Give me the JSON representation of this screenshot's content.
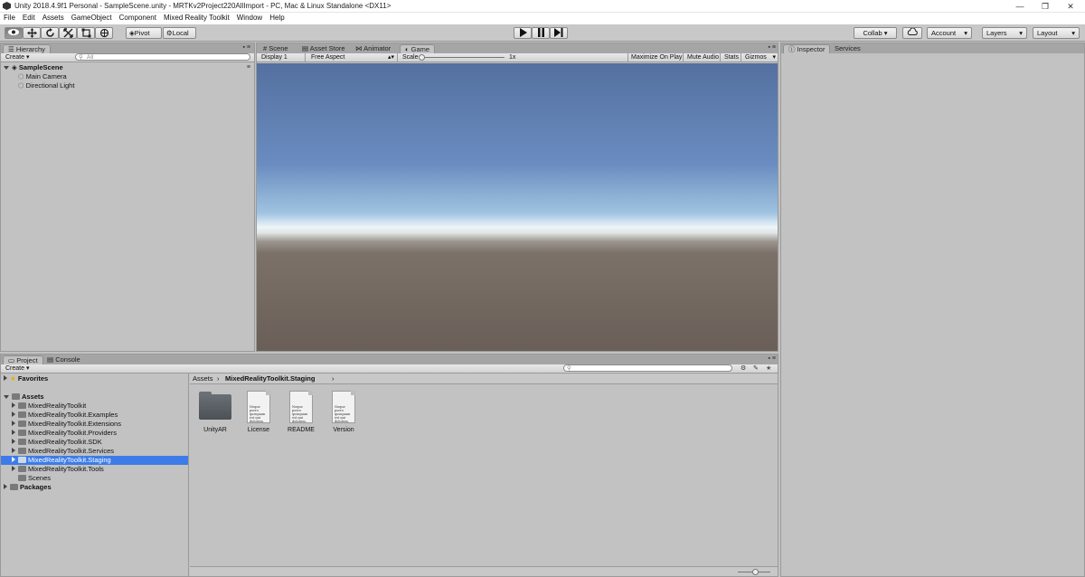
{
  "window": {
    "title": "Unity 2018.4.9f1 Personal - SampleScene.unity - MRTKv2Project220AllImport - PC, Mac & Linux Standalone <DX11>"
  },
  "window_controls": {
    "minimize": "—",
    "maximize": "❐",
    "close": "✕"
  },
  "menu": [
    "File",
    "Edit",
    "Assets",
    "GameObject",
    "Component",
    "Mixed Reality Toolkit",
    "Window",
    "Help"
  ],
  "toolbar": {
    "pivot": "Pivot",
    "local": "Local",
    "collab": "Collab ▾",
    "account": "Account",
    "layers": "Layers",
    "layout": "Layout"
  },
  "hierarchy": {
    "tab": "Hierarchy",
    "create": "Create ▾",
    "search_placeholder": "All",
    "scene": "SampleScene",
    "items": [
      "Main Camera",
      "Directional Light"
    ]
  },
  "scene_tabs": [
    "Scene",
    "Asset Store",
    "Animator",
    "Game"
  ],
  "game_bar": {
    "display": "Display 1",
    "aspect": "Free Aspect",
    "scale_label": "Scale",
    "scale_value": "1x",
    "maximize": "Maximize On Play",
    "mute": "Mute Audio",
    "stats": "Stats",
    "gizmos": "Gizmos"
  },
  "inspector_tabs": [
    "Inspector",
    "Services"
  ],
  "project": {
    "tabs": [
      "Project",
      "Console"
    ],
    "create": "Create ▾",
    "favorites": "Favorites",
    "assets_root": "Assets",
    "folders": [
      "MixedRealityToolkit",
      "MixedRealityToolkit.Examples",
      "MixedRealityToolkit.Extensions",
      "MixedRealityToolkit.Providers",
      "MixedRealityToolkit.SDK",
      "MixedRealityToolkit.Services",
      "MixedRealityToolkit.Staging",
      "MixedRealityToolkit.Tools",
      "Scenes"
    ],
    "selected_folder": "MixedRealityToolkit.Staging",
    "packages": "Packages",
    "breadcrumb": [
      "Assets",
      "MixedRealityToolkit.Staging"
    ],
    "assets": [
      {
        "name": "UnityAR",
        "type": "folder"
      },
      {
        "name": "License",
        "type": "text"
      },
      {
        "name": "README",
        "type": "text"
      },
      {
        "name": "Version",
        "type": "text"
      }
    ],
    "doc_preview_text": "Neque porro quisquam est qui dolorem."
  },
  "colors": {
    "selection": "#3d7ce8",
    "sky_top": "#5572a0",
    "horizon": "#eef4f8",
    "ground": "#6a5f58"
  }
}
